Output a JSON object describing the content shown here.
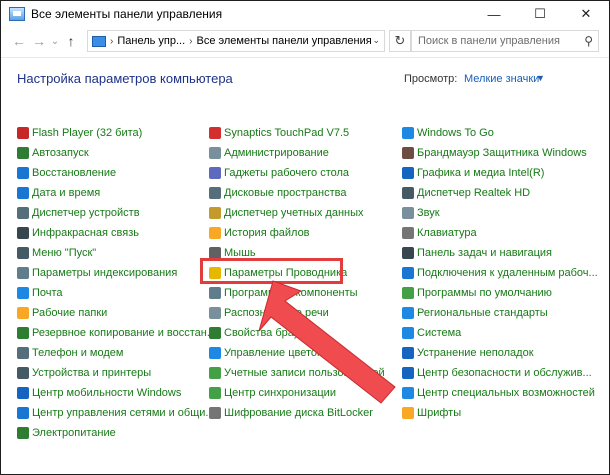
{
  "window": {
    "title": "Все элементы панели управления",
    "controls": {
      "minimize": "—",
      "maximize": "☐",
      "close": "✕"
    }
  },
  "addressbar": {
    "back": "←",
    "forward": "→",
    "recent": "⌄",
    "up": "↑",
    "breadcrumb": [
      "Панель упр...",
      "Все элементы панели управления"
    ],
    "separator": "›",
    "dropdown": "⌄",
    "refresh": "↻",
    "search_placeholder": "Поиск в панели управления",
    "search_glyph": "⚲"
  },
  "header": {
    "title": "Настройка параметров компьютера",
    "view_by_label": "Просмотр:",
    "view_by_value": "Мелкие значки",
    "view_by_arrow": "▼"
  },
  "columns": [
    [
      {
        "label": "Flash Player (32 бита)",
        "icon": "flash-icon",
        "color": "#c62828"
      },
      {
        "label": "Автозапуск",
        "icon": "autoplay-icon",
        "color": "#2e7d32"
      },
      {
        "label": "Восстановление",
        "icon": "recovery-icon",
        "color": "#1976d2"
      },
      {
        "label": "Дата и время",
        "icon": "clock-icon",
        "color": "#1976d2"
      },
      {
        "label": "Диспетчер устройств",
        "icon": "device-manager-icon",
        "color": "#546e7a"
      },
      {
        "label": "Инфракрасная связь",
        "icon": "infrared-icon",
        "color": "#37474f"
      },
      {
        "label": "Меню \"Пуск\"",
        "icon": "start-menu-icon",
        "color": "#455a64"
      },
      {
        "label": "Параметры индексирования",
        "icon": "indexing-icon",
        "color": "#607d8b"
      },
      {
        "label": "Почта",
        "icon": "mail-icon",
        "color": "#1e88e5"
      },
      {
        "label": "Рабочие папки",
        "icon": "work-folders-icon",
        "color": "#f9a825"
      },
      {
        "label": "Резервное копирование и восстан...",
        "icon": "backup-icon",
        "color": "#2e7d32"
      },
      {
        "label": "Телефон и модем",
        "icon": "phone-icon",
        "color": "#546e7a"
      },
      {
        "label": "Устройства и принтеры",
        "icon": "printer-icon",
        "color": "#455a64"
      },
      {
        "label": "Центр мобильности Windows",
        "icon": "mobility-icon",
        "color": "#1565c0"
      },
      {
        "label": "Центр управления сетями и общи...",
        "icon": "network-icon",
        "color": "#1976d2"
      },
      {
        "label": "Электропитание",
        "icon": "power-icon",
        "color": "#2e7d32"
      }
    ],
    [
      {
        "label": "Synaptics TouchPad V7.5",
        "icon": "touchpad-icon",
        "color": "#d32f2f"
      },
      {
        "label": "Администрирование",
        "icon": "admin-tools-icon",
        "color": "#78909c"
      },
      {
        "label": "Гаджеты рабочего стола",
        "icon": "gadgets-icon",
        "color": "#5c6bc0"
      },
      {
        "label": "Дисковые пространства",
        "icon": "storage-icon",
        "color": "#546e7a"
      },
      {
        "label": "Диспетчер учетных данных",
        "icon": "credentials-icon",
        "color": "#c49a2c"
      },
      {
        "label": "История файлов",
        "icon": "file-history-icon",
        "color": "#f9a825"
      },
      {
        "label": "Мышь",
        "icon": "mouse-icon",
        "color": "#616161"
      },
      {
        "label": "Параметры Проводника",
        "icon": "explorer-options-icon",
        "color": "#e6b800"
      },
      {
        "label": "Программы и компоненты",
        "icon": "programs-icon",
        "color": "#607d8b"
      },
      {
        "label": "Распознавание речи",
        "icon": "speech-icon",
        "color": "#78909c"
      },
      {
        "label": "Свойства браузера",
        "icon": "browser-icon",
        "color": "#2e7d32"
      },
      {
        "label": "Управление цветом",
        "icon": "color-icon",
        "color": "#1e88e5"
      },
      {
        "label": "Учетные записи пользователей",
        "icon": "users-icon",
        "color": "#43a047"
      },
      {
        "label": "Центр синхронизации",
        "icon": "sync-icon",
        "color": "#43a047"
      },
      {
        "label": "Шифрование диска BitLocker",
        "icon": "bitlocker-icon",
        "color": "#757575"
      }
    ],
    [
      {
        "label": "Windows To Go",
        "icon": "windows-to-go-icon",
        "color": "#1e88e5"
      },
      {
        "label": "Брандмауэр Защитника Windows",
        "icon": "firewall-icon",
        "color": "#6d4c41"
      },
      {
        "label": "Графика и медиа Intel(R)",
        "icon": "intel-graphics-icon",
        "color": "#1565c0"
      },
      {
        "label": "Диспетчер Realtek HD",
        "icon": "realtek-icon",
        "color": "#455a64"
      },
      {
        "label": "Звук",
        "icon": "sound-icon",
        "color": "#78909c"
      },
      {
        "label": "Клавиатура",
        "icon": "keyboard-icon",
        "color": "#757575"
      },
      {
        "label": "Панель задач и навигация",
        "icon": "taskbar-icon",
        "color": "#37474f"
      },
      {
        "label": "Подключения к удаленным рабоч...",
        "icon": "remote-desktop-icon",
        "color": "#1976d2"
      },
      {
        "label": "Программы по умолчанию",
        "icon": "default-programs-icon",
        "color": "#43a047"
      },
      {
        "label": "Региональные стандарты",
        "icon": "region-icon",
        "color": "#1e88e5"
      },
      {
        "label": "Система",
        "icon": "system-icon",
        "color": "#1e88e5"
      },
      {
        "label": "Устранение неполадок",
        "icon": "troubleshoot-icon",
        "color": "#1565c0"
      },
      {
        "label": "Центр безопасности и обслужив...",
        "icon": "security-center-icon",
        "color": "#1565c0"
      },
      {
        "label": "Центр специальных возможностей",
        "icon": "accessibility-icon",
        "color": "#1e88e5"
      },
      {
        "label": "Шрифты",
        "icon": "fonts-icon",
        "color": "#f9a825"
      }
    ]
  ],
  "annotation": {
    "highlight_color": "#e23c3c",
    "arrow_color": "#f04b4f"
  }
}
